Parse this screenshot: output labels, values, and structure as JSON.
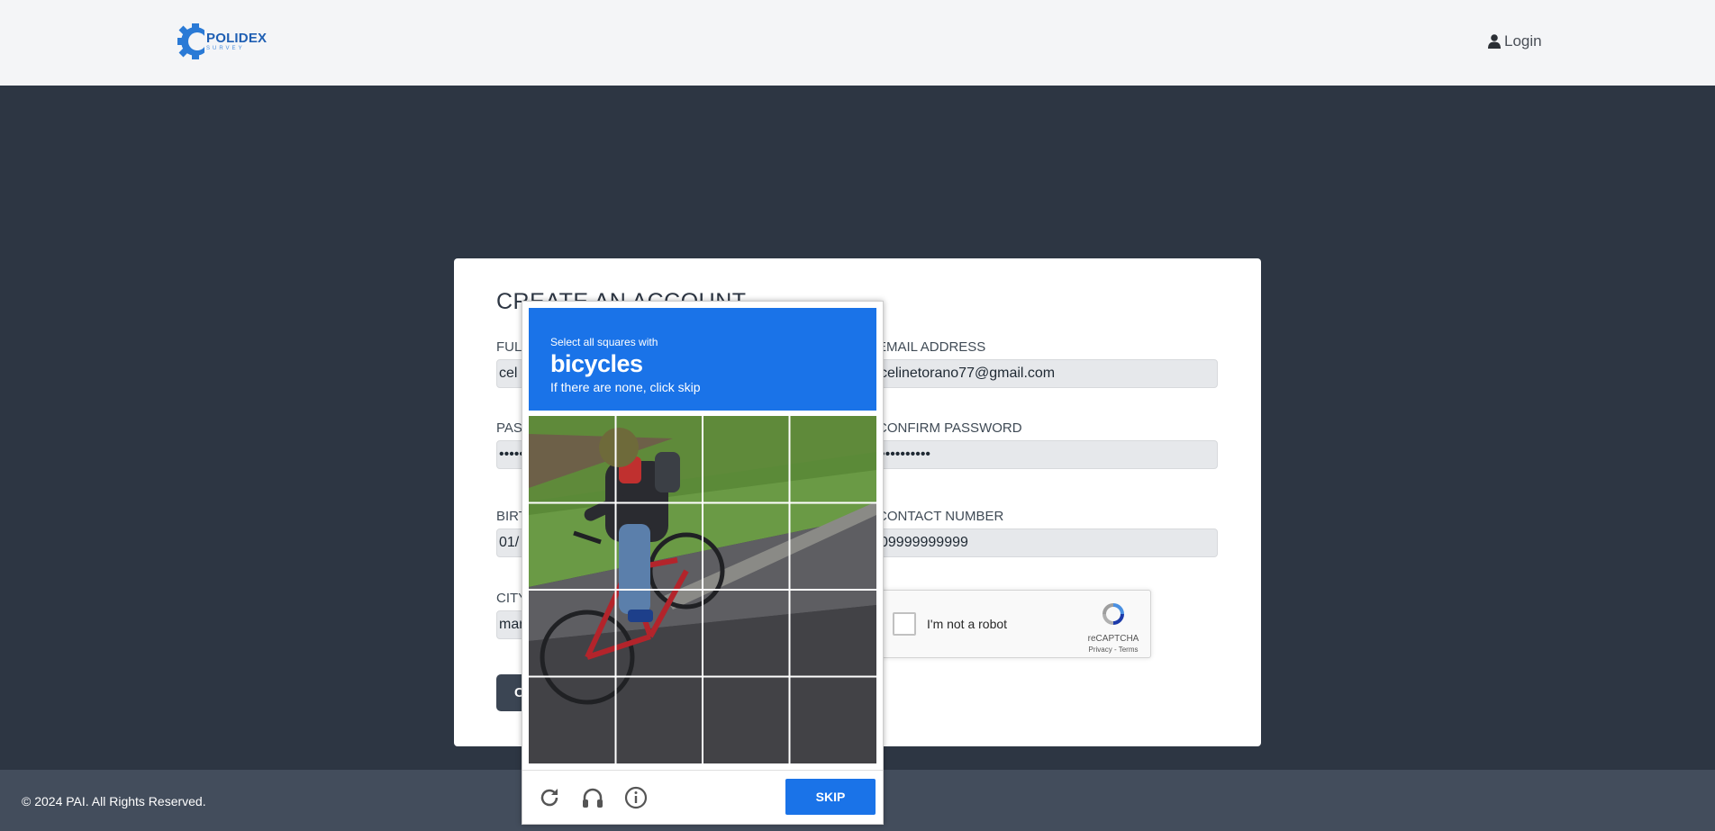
{
  "header": {
    "logo_title": "POLIDEX",
    "logo_subtitle": "SURVEY",
    "login_label": "Login"
  },
  "form": {
    "title": "CREATE AN ACCOUNT",
    "full_name_label": "FULL NAME",
    "full_name_value": "cel",
    "email_label": "EMAIL ADDRESS",
    "email_value": "celinetorano77@gmail.com",
    "password_label": "PASSWORD",
    "password_value": "••••••••••",
    "confirm_password_label": "CONFIRM PASSWORD",
    "confirm_password_value": "••••••••••",
    "birthdate_label": "BIRTHDATE",
    "birthdate_value": "01/",
    "contact_label": "CONTACT NUMBER",
    "contact_value": "09999999999",
    "city_label": "CITY",
    "city_value": "mar",
    "create_button_label": "C"
  },
  "recaptcha": {
    "checkbox_label": "I'm not a robot",
    "brand": "reCAPTCHA",
    "links": "Privacy - Terms"
  },
  "challenge": {
    "instruction_small": "Select all squares with",
    "target_object": "bicycles",
    "instruction_sub": "If there are none, click skip",
    "skip_label": "SKIP",
    "icons": [
      "reload-icon",
      "headphones-icon",
      "info-icon"
    ],
    "grid_rows": 4,
    "grid_cols": 4
  },
  "footer": {
    "copyright": "© 2024 PAI. All Rights Reserved."
  },
  "colors": {
    "page_bg": "#2d3643",
    "topbar_bg": "#f4f5f7",
    "footer_bg": "#434d5c",
    "challenge_blue": "#1a73e8",
    "brand_blue": "#1f5fb3"
  }
}
